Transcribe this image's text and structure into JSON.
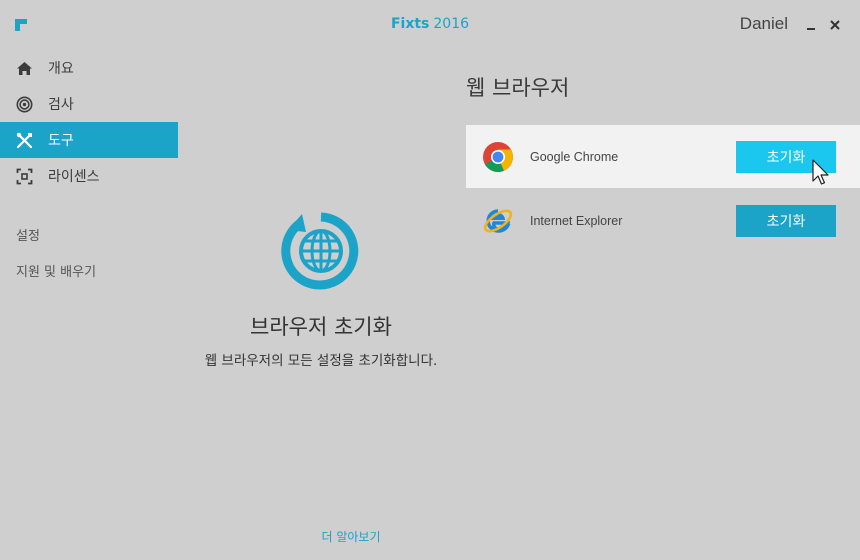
{
  "titlebar": {
    "brand": "Fixts",
    "year": "2016",
    "user": "Daniel",
    "minimize_icon": "minimize-icon",
    "close_icon": "close-icon"
  },
  "sidebar": {
    "items": [
      {
        "label": "개요",
        "icon": "home-icon"
      },
      {
        "label": "검사",
        "icon": "scan-target-icon"
      },
      {
        "label": "도구",
        "icon": "tools-icon",
        "active": true
      },
      {
        "label": "라이센스",
        "icon": "license-scan-icon"
      }
    ],
    "settings_label": "설정",
    "support_label": "지원 및 배우기"
  },
  "feature": {
    "icon": "browser-reset-globe-icon",
    "title": "브라우저 초기화",
    "description": "웹 브라우저의 모든 설정을 초기화합니다.",
    "learn_more": "더 알아보기"
  },
  "browsers": {
    "title": "웹 브라우저",
    "items": [
      {
        "name": "Google Chrome",
        "icon": "chrome-icon",
        "button": "초기화",
        "hovered": true
      },
      {
        "name": "Internet Explorer",
        "icon": "internet-explorer-icon",
        "button": "초기화",
        "hovered": false
      }
    ]
  },
  "colors": {
    "accent": "#1ba3c8",
    "accent_hover": "#1bc7ee",
    "background": "#cfcfcf",
    "row_hover": "#f2f2f2"
  }
}
